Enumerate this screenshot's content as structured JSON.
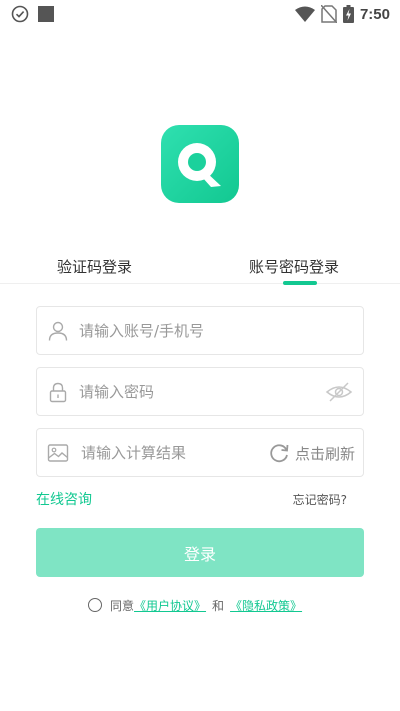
{
  "status_bar": {
    "time": "7:50",
    "icons": [
      "check-circle-icon",
      "square-notification-icon",
      "wifi-icon",
      "no-sim-icon",
      "battery-charging-icon"
    ]
  },
  "logo": {
    "icon": "q-logo-icon",
    "colors": [
      "#2fe0b0",
      "#12c891"
    ]
  },
  "tabs": [
    {
      "label": "验证码登录",
      "active": false
    },
    {
      "label": "账号密码登录",
      "active": true
    }
  ],
  "form": {
    "account": {
      "placeholder": "请输入账号/手机号",
      "value": "",
      "icon": "user-icon"
    },
    "password": {
      "placeholder": "请输入密码",
      "value": "",
      "icon": "lock-icon",
      "toggle_icon": "eye-hidden-icon"
    },
    "captcha": {
      "placeholder": "请输入计算结果",
      "value": "",
      "icon": "image-icon",
      "refresh_label": "点击刷新",
      "refresh_icon": "refresh-icon"
    }
  },
  "links": {
    "consult": "在线咨询",
    "forgot": "忘记密码?"
  },
  "login_button": {
    "label": "登录"
  },
  "agreement": {
    "checked": false,
    "prefix": "同意",
    "user_agreement": "《用户协议》",
    "and": "和",
    "privacy_policy": "《隐私政策》"
  },
  "colors": {
    "accent": "#12c891",
    "button_disabled": "#7fe4c4",
    "border": "#e6e6e6"
  }
}
